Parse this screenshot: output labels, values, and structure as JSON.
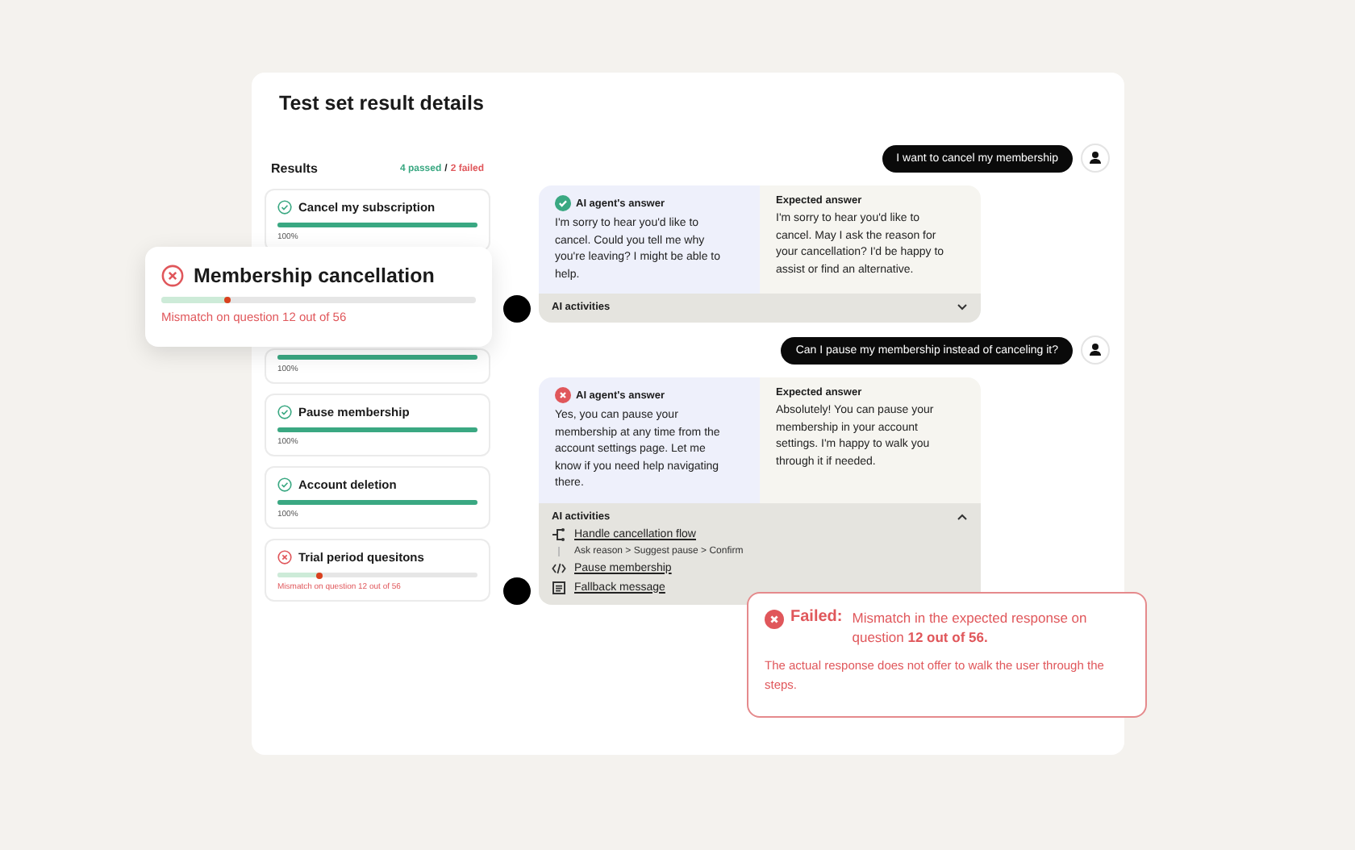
{
  "title": "Test set result details",
  "results": {
    "heading": "Results",
    "passed": "4 passed",
    "separator": "/",
    "failed": "2 failed",
    "items": [
      {
        "passed": true,
        "title": "Cancel my subscription",
        "level": 1,
        "caption": "100%"
      },
      {
        "level": 1,
        "caption": "100%"
      },
      {
        "passed": true,
        "title": "Pause membership",
        "level": 1,
        "caption": "100%"
      },
      {
        "passed": true,
        "title": "Account deletion",
        "level": 1,
        "caption": "100%"
      },
      {
        "passed": false,
        "title": "Trial period quesitons",
        "level": 0.21,
        "caption": "Mismatch on question 12 out of 56"
      }
    ]
  },
  "highlight": {
    "passed": false,
    "title": "Membership cancellation",
    "level": 0.21,
    "caption": "Mismatch on question 12 out of 56"
  },
  "conversation": [
    {
      "question": "I want to cancel my membership",
      "passed": true,
      "answer_label": "AI agent's answer",
      "answer": "I'm sorry to hear you'd like to cancel. Could you tell me why you're leaving? I might be able to help.",
      "expected_label": "Expected answer",
      "expected": "I'm sorry to hear you'd like to cancel. May I ask the reason for your cancellation? I'd be happy to assist or find an alternative.",
      "activities_label": "AI activities",
      "expanded": false
    },
    {
      "question": "Can I pause my membership instead of canceling it?",
      "passed": false,
      "answer_label": "AI agent's answer",
      "answer": "Yes, you can pause your membership at any time from the account settings page. Let me know if you need help navigating there.",
      "expected_label": "Expected answer",
      "expected": "Absolutely! You can pause your membership in your account settings. I'm happy to walk you through it if needed.",
      "activities_label": "AI activities",
      "expanded": true,
      "activities": [
        {
          "kind": "flow",
          "label": "Handle cancellation flow",
          "steps": "Ask reason > Suggest pause > Confirm"
        },
        {
          "kind": "code",
          "label": "Pause membership"
        },
        {
          "kind": "message",
          "label": "Fallback message"
        }
      ]
    }
  ],
  "failure": {
    "label": "Failed:",
    "message": "Mismatch in the expected response on question **12 out of 56.**",
    "detail": "The actual response does not offer to walk the user through the steps."
  }
}
